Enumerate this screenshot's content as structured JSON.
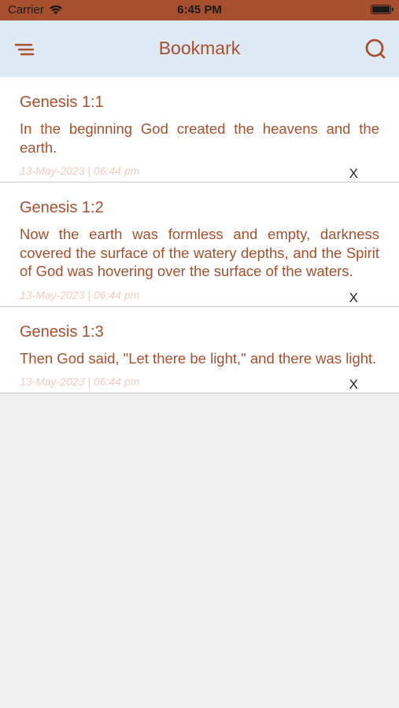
{
  "status_bar": {
    "carrier": "Carrier",
    "time": "6:45 PM"
  },
  "nav": {
    "title": "Bookmark",
    "menu_icon": "menu-icon",
    "search_icon": "search-icon"
  },
  "colors": {
    "accent": "#a8502e",
    "nav_background": "#dde9f3",
    "date_text": "#f2c9c5",
    "page_background": "#f0f0f0"
  },
  "bookmarks": [
    {
      "reference": "Genesis 1:1",
      "text": "In the beginning God created the heavens and the earth.",
      "date": "13-May-2023 | 06:44 pm",
      "remove_label": "X"
    },
    {
      "reference": "Genesis 1:2",
      "text": "Now the earth was formless and empty, darkness covered the surface of the watery depths, and the Spirit of God was hovering over the surface of the waters.",
      "date": "13-May-2023 | 06:44 pm",
      "remove_label": "X"
    },
    {
      "reference": "Genesis 1:3",
      "text": "Then God said, \"Let there be light,\" and there was light.",
      "date": "13-May-2023 | 06:44 pm",
      "remove_label": "X"
    }
  ]
}
